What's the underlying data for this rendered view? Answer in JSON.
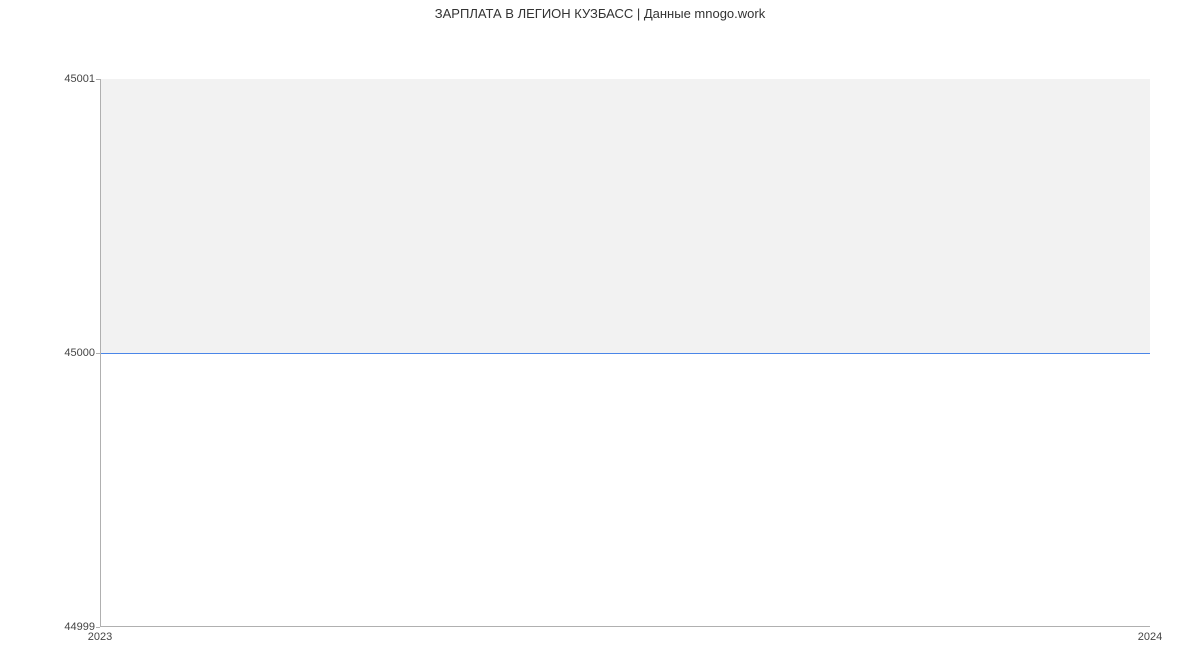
{
  "chart_data": {
    "type": "area",
    "title": "ЗАРПЛАТА В ЛЕГИОН КУЗБАСС | Данные mnogo.work",
    "xlabel": "",
    "ylabel": "",
    "x": [
      "2023",
      "2024"
    ],
    "y": [
      45000,
      45000
    ],
    "ylim": [
      44999,
      45001
    ],
    "y_ticks": [
      44999,
      45000,
      45001
    ],
    "x_ticks": [
      "2023",
      "2024"
    ],
    "line_color": "#4a86e8",
    "fill_color": "#f2f2f2",
    "fill_to": 45001
  }
}
